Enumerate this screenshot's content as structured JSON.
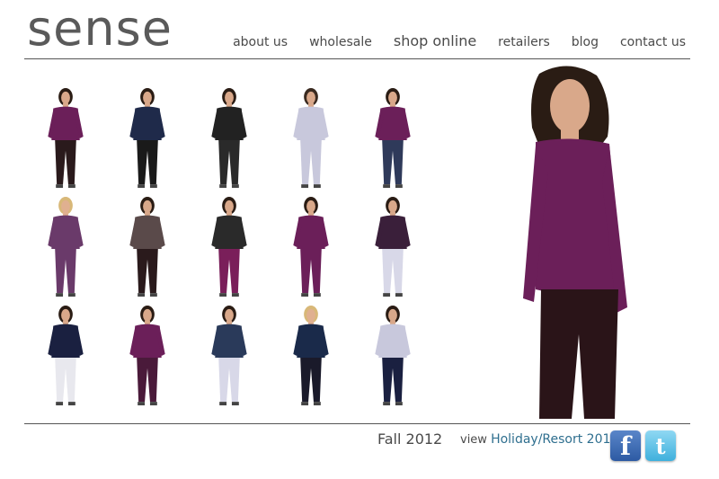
{
  "brand": {
    "logo": "sense"
  },
  "nav": {
    "items": [
      {
        "label": "about us"
      },
      {
        "label": "wholesale"
      },
      {
        "label": "shop online"
      },
      {
        "label": "retailers"
      },
      {
        "label": "blog"
      },
      {
        "label": "contact us"
      }
    ]
  },
  "gallery": {
    "thumbnails": [
      {
        "top": "#6b1f59",
        "bottom": "#2a1a1c",
        "skin": "#d9a88a",
        "hair": "#2a1c14"
      },
      {
        "top": "#1f2a4a",
        "bottom": "#1a1a1a",
        "skin": "#d9a88a",
        "hair": "#2a1c14"
      },
      {
        "top": "#222222",
        "bottom": "#2a2a2a",
        "skin": "#d9a88a",
        "hair": "#2a1c14"
      },
      {
        "top": "#c8c8dc",
        "bottom": "#c8c8dc",
        "skin": "#d9a88a",
        "hair": "#3a2a20"
      },
      {
        "top": "#6b1f59",
        "bottom": "#2f3a5a",
        "skin": "#d9a88a",
        "hair": "#2a1c14"
      },
      {
        "top": "#6a3a6a",
        "bottom": "#6a3a6a",
        "skin": "#e0b090",
        "hair": "#d8b878"
      },
      {
        "top": "#5a4a4a",
        "bottom": "#2a1a1c",
        "skin": "#d9a88a",
        "hair": "#2a1c14"
      },
      {
        "top": "#2a2a2a",
        "bottom": "#7a1f5a",
        "skin": "#d9a88a",
        "hair": "#2a1c14"
      },
      {
        "top": "#6b1f59",
        "bottom": "#6b1f59",
        "skin": "#d9a88a",
        "hair": "#2a1c14"
      },
      {
        "top": "#3a1f3a",
        "bottom": "#d8d8e8",
        "skin": "#d9a88a",
        "hair": "#2a1c14"
      },
      {
        "top": "#1a2040",
        "bottom": "#e8e8ee",
        "skin": "#d9a88a",
        "hair": "#2a1c14"
      },
      {
        "top": "#6b1f59",
        "bottom": "#4a1a3a",
        "skin": "#d9a88a",
        "hair": "#2a1c14"
      },
      {
        "top": "#2a3a5a",
        "bottom": "#d8d8e8",
        "skin": "#d9a88a",
        "hair": "#2a1c14"
      },
      {
        "top": "#1a2a4a",
        "bottom": "#1a1a2a",
        "skin": "#e0b090",
        "hair": "#d8b878"
      },
      {
        "top": "#c8c8dc",
        "bottom": "#1a2040",
        "skin": "#d9a88a",
        "hair": "#2a1c14"
      }
    ]
  },
  "hero": {
    "top": "#6b1f59",
    "bottom": "#2a1418",
    "skin": "#d9a88a",
    "hair": "#2a1c14"
  },
  "footer": {
    "season": "Fall 2012",
    "view_prefix": "view",
    "view_link": "Holiday/Resort 2012",
    "facebook_glyph": "f",
    "twitter_glyph": "t"
  }
}
